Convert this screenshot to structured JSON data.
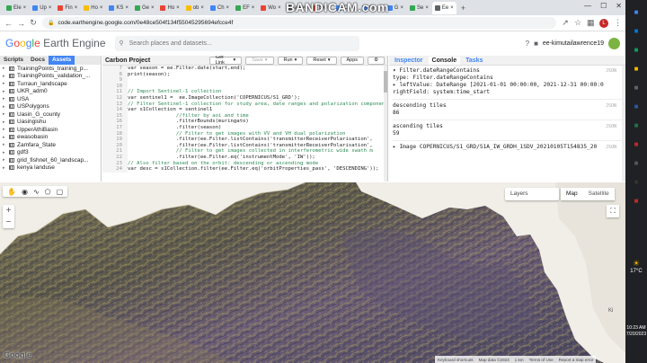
{
  "browser": {
    "tabs": [
      {
        "label": "Ele",
        "color": "#34a853"
      },
      {
        "label": "Up",
        "color": "#4285f4"
      },
      {
        "label": "Fin",
        "color": "#ea4335"
      },
      {
        "label": "Ho",
        "color": "#fbbc05"
      },
      {
        "label": "KS",
        "color": "#4285f4"
      },
      {
        "label": "Ge",
        "color": "#34a853"
      },
      {
        "label": "Ho",
        "color": "#ea4335"
      },
      {
        "label": "ob",
        "color": "#fbbc05"
      },
      {
        "label": "Ch",
        "color": "#4285f4"
      },
      {
        "label": "EF",
        "color": "#34a853"
      },
      {
        "label": "Wo",
        "color": "#ea4335"
      },
      {
        "label": "ab",
        "color": "#5f6368"
      },
      {
        "label": "Ex",
        "color": "#ea4335"
      },
      {
        "label": "Ch",
        "color": "#4285f4"
      },
      {
        "label": "Ch",
        "color": "#4285f4"
      },
      {
        "label": "G",
        "color": "#4285f4"
      },
      {
        "label": "Se",
        "color": "#34a853"
      },
      {
        "label": "Ee",
        "color": "#5f6368"
      }
    ],
    "url": "code.earthengine.google.com/0e48ce504f134f55045295694efcce4f",
    "recording_overlay": "BANDICAM.com",
    "profile_initial": "L"
  },
  "gee": {
    "logo": {
      "google": "Google",
      "earth_engine": "Earth Engine"
    },
    "search_placeholder": "Search places and datasets...",
    "account": "ee-kimutailawrence19"
  },
  "left_panel": {
    "tabs": [
      "Scripts",
      "Docs",
      "Assets"
    ],
    "active_tab": "Assets",
    "items": [
      "TrainingPoints_training_p...",
      "TrainingPoints_validation_...",
      "Turraun_landscape",
      "UKR_adm0",
      "USA",
      "USPolygons",
      "Uasin_G_county",
      "Uasingishu",
      "UpperAthiBasin",
      "ewasobasin",
      "Zamfara_State",
      "gdf3",
      "grid_fishnet_60_landscap...",
      "kenya landuse"
    ]
  },
  "editor": {
    "title": "Carbon Project",
    "buttons": {
      "get_link": "Get Link",
      "save": "Save",
      "run": "Run",
      "reset": "Reset",
      "apps": "Apps"
    },
    "lines": [
      {
        "n": "7",
        "text": "var season = ee.Filter.date(start,end);",
        "type": "code"
      },
      {
        "n": "8",
        "text": "print(season);",
        "type": "code"
      },
      {
        "n": "9",
        "text": "",
        "type": "code"
      },
      {
        "n": "10",
        "text": "",
        "type": "code"
      },
      {
        "n": "11",
        "text": "// Import Sentinel-1 collection",
        "type": "comment"
      },
      {
        "n": "12",
        "text": "var sentinel1 =  ee.ImageCollection('COPERNICUS/S1_GRD');",
        "type": "code"
      },
      {
        "n": "13",
        "text": "// Filter Sentinel-1 collection for study area, date ranges and polarization componen",
        "type": "comment"
      },
      {
        "n": "14",
        "text": "var s1Collection = sentinel1",
        "type": "code"
      },
      {
        "n": "15",
        "text": "                //filter by aoi and time",
        "type": "comment"
      },
      {
        "n": "16",
        "text": "                .filterBounds(muringato)",
        "type": "code"
      },
      {
        "n": "17",
        "text": "                .filter(season)",
        "type": "code"
      },
      {
        "n": "18",
        "text": "                // Filter to get images with VV and VH dual polarization",
        "type": "comment"
      },
      {
        "n": "19",
        "text": "                .filter(ee.Filter.listContains('transmitterReceiverPolarisation',",
        "type": "code"
      },
      {
        "n": "20",
        "text": "                .filter(ee.Filter.listContains('transmitterReceiverPolarisation',",
        "type": "code"
      },
      {
        "n": "21",
        "text": "                // Filter to get images collected in interferometric wide swath m",
        "type": "comment"
      },
      {
        "n": "22",
        "text": "                .filter(ee.Filter.eq('instrumentMode', 'IW'));",
        "type": "code"
      },
      {
        "n": "23",
        "text": "// Also filter based on the orbit: descending or ascending mode",
        "type": "comment"
      },
      {
        "n": "24",
        "text": "var desc = s1Collection.filter(ee.Filter.eq('orbitProperties_pass', 'DESCENDING'));",
        "type": "code"
      }
    ]
  },
  "right_panel": {
    "tabs": [
      "Inspector",
      "Console",
      "Tasks"
    ],
    "active_tab": "Console",
    "json_tag": "JSON",
    "entries": [
      {
        "lines": [
          "▾ Filter.dateRangeContains",
          "    type: Filter.dateRangeContains",
          "  ▸ leftValue: DateRange [2021-01-01 00:00:00, 2021-12-31 00:00:0",
          "    rightField: system:time_start"
        ]
      },
      {
        "lines": [
          "descending tiles",
          "86"
        ]
      },
      {
        "lines": [
          "ascending tiles",
          "59"
        ]
      },
      {
        "lines": [
          "▸ Image COPERNICUS/S1_GRD/S1A_IW_GRDH_1SDV_20210105T154835_20"
        ]
      }
    ]
  },
  "map": {
    "layers_label": "Layers",
    "map_type": [
      "Map",
      "Satellite"
    ],
    "active_map_type": "Map",
    "google_mark": "Google",
    "attribution": [
      "Keyboard shortcuts",
      "Map data ©2023",
      "1 km",
      "Terms of Use",
      "Report a map error"
    ],
    "place_label": "Ki"
  },
  "taskbar": {
    "temperature": "17°C",
    "time": "10:23 AM",
    "date": "7/20/2023",
    "icons": [
      {
        "name": "chrome-icon",
        "color": "#4285f4"
      },
      {
        "name": "mail-icon",
        "color": "#0078d4"
      },
      {
        "name": "edge-icon",
        "color": "#0f9d58"
      },
      {
        "name": "folder-icon",
        "color": "#f4b400"
      },
      {
        "name": "store-icon",
        "color": "#5f6368"
      },
      {
        "name": "word-icon",
        "color": "#2b579a"
      },
      {
        "name": "excel-icon",
        "color": "#217346"
      },
      {
        "name": "app-icon",
        "color": "#c62828"
      },
      {
        "name": "media-icon",
        "color": "#555555"
      },
      {
        "name": "terminal-icon",
        "color": "#333333"
      },
      {
        "name": "record-icon",
        "color": "#c62828"
      }
    ]
  }
}
